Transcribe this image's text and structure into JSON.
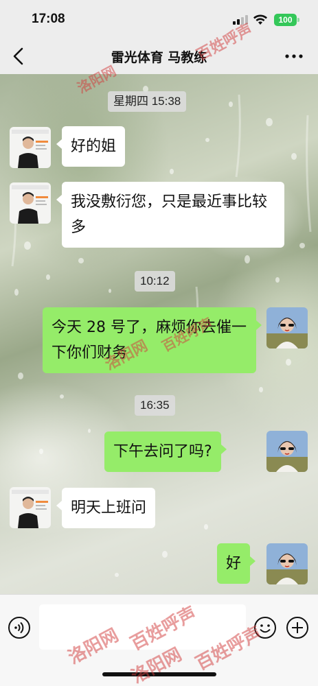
{
  "status_bar": {
    "time": "17:08",
    "battery": "100"
  },
  "nav": {
    "title": "雷光体育  马教练"
  },
  "timestamps": [
    "星期四 15:38",
    "10:12",
    "16:35"
  ],
  "messages": [
    {
      "side": "left",
      "sender": "coach",
      "text": "好的姐"
    },
    {
      "side": "left",
      "sender": "coach",
      "text": "我没敷衍您，只是最近事比较多"
    },
    {
      "side": "right",
      "sender": "me",
      "text": "今天 28 号了，麻烦你去催一下你们财务"
    },
    {
      "side": "right",
      "sender": "me",
      "text": "下午去问了吗?"
    },
    {
      "side": "left",
      "sender": "coach",
      "text": "明天上班问"
    },
    {
      "side": "right",
      "sender": "me",
      "text": "好"
    }
  ],
  "watermark": {
    "text": "洛阳网 百姓呼声",
    "color": "#d23c3c"
  },
  "colors": {
    "self_bubble": "#95ec69",
    "other_bubble": "#ffffff",
    "battery": "#34c759"
  },
  "icons": {
    "back": "chevron-left-icon",
    "more": "ellipsis-icon",
    "voice": "voice-icon",
    "emoji": "emoji-icon",
    "plus": "plus-icon"
  }
}
